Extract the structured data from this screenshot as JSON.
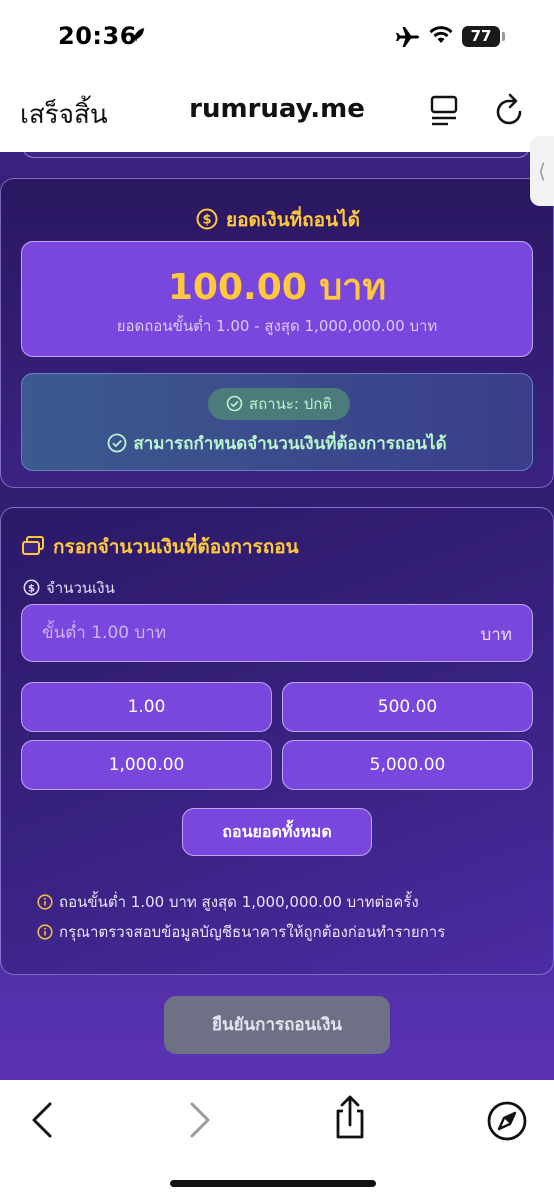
{
  "status_bar": {
    "time": "20:36",
    "battery": "77"
  },
  "browser": {
    "done_label": "เสร็จสิ้น",
    "url": "rumruay.me"
  },
  "balance_card": {
    "title": "ยอดเงินที่ถอนได้",
    "amount": "100.00 บาท",
    "range": "ยอดถอนขั้นต่ำ 1.00 - สูงสุด 1,000,000.00 บาท",
    "status_pill": "สถานะ: ปกติ",
    "status_message": "สามารถกำหนดจำนวนเงินที่ต้องการถอนได้"
  },
  "withdraw_form": {
    "title": "กรอกจำนวนเงินที่ต้องการถอน",
    "field_label": "จำนวนเงิน",
    "placeholder": "ขั้นต่ำ 1.00 บาท",
    "unit": "บาท",
    "quick_amounts": [
      "1.00",
      "500.00",
      "1,000.00",
      "5,000.00"
    ],
    "withdraw_all": "ถอนยอดทั้งหมด",
    "notes": [
      "ถอนขั้นต่ำ 1.00 บาท สูงสุด 1,000,000.00 บาทต่อครั้ง",
      "กรุณาตรวจสอบข้อมูลบัญชีธนาคารให้ถูกต้องก่อนทำรายการ"
    ]
  },
  "confirm_button": "ยืนยันการถอนเงิน",
  "side_tab": "⟨",
  "colors": {
    "accent_gold": "#ffc83d",
    "panel_purple": "#7a47de",
    "status_green": "#b9f5cf"
  }
}
